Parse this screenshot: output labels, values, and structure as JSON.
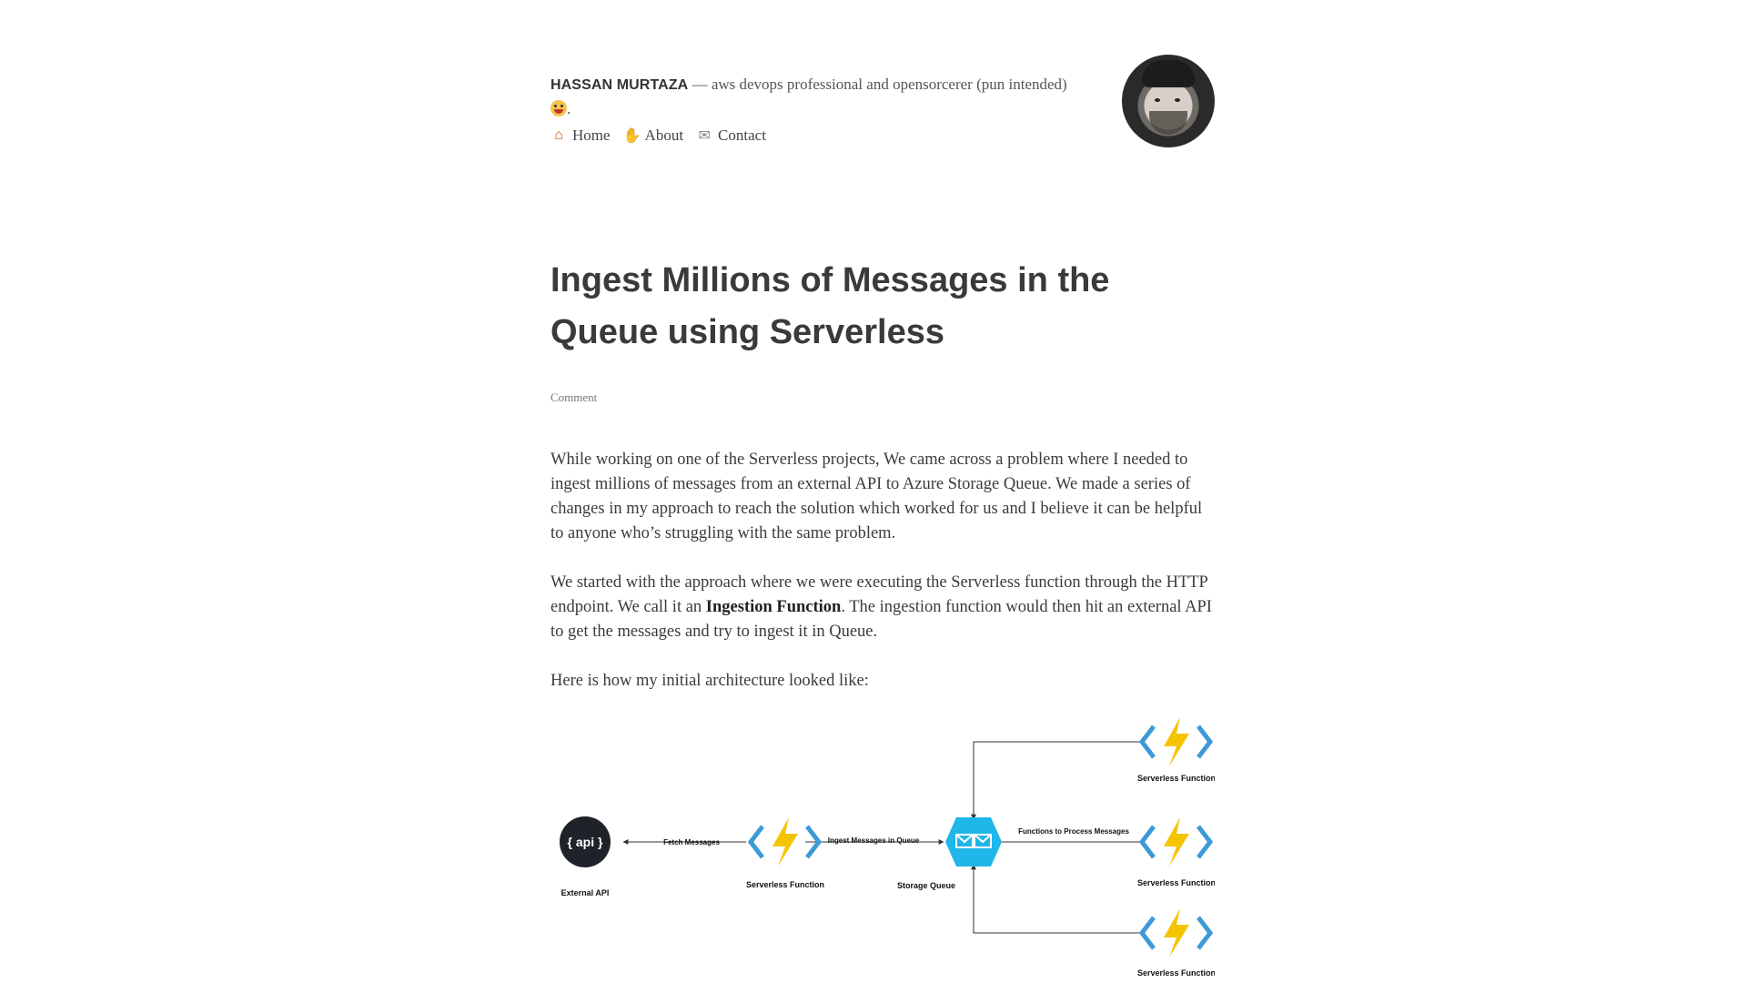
{
  "header": {
    "site_title": "HASSAN MURTAZA",
    "tagline": " — aws devops professional and opensorcerer (pun intended)",
    "tagline_end": ".",
    "nav": [
      {
        "label": "Home",
        "icon": "house-icon"
      },
      {
        "label": "About",
        "icon": "waving-hand-icon"
      },
      {
        "label": "Contact",
        "icon": "envelope-icon"
      }
    ]
  },
  "post": {
    "title": "Ingest Millions of Messages in the Queue using Serverless",
    "comment_label": "Comment",
    "paragraphs": {
      "p1": "While working on one of the Serverless projects, We came across a problem where I needed to ingest millions of messages from an external API to Azure Storage Queue. We made a series of changes in my approach to reach the solution which worked for us and I believe it can be helpful to anyone who’s struggling with the same problem.",
      "p2_start": "We started with the approach where we were executing the Serverless function through the HTTP endpoint. We call it an ",
      "p2_bold": "Ingestion Function",
      "p2_end": ". The ingestion function would then hit an external API to get the messages and try to ingest it in Queue.",
      "p3": "Here is how my initial architecture looked like:"
    }
  },
  "diagram": {
    "api_label": "{ api }",
    "external_api": "External API",
    "fetch_messages": "Fetch Messages",
    "serverless_function": "Serverless Function",
    "ingest_messages": "Ingest Messages in Queue",
    "storage_queue": "Storage Queue",
    "functions_process": "Functions to Process Messages",
    "colors": {
      "bolt": "#f5c400",
      "chevron": "#3c9ad6",
      "queue": "#1fb6e8",
      "api_bg": "#1e2329"
    }
  }
}
